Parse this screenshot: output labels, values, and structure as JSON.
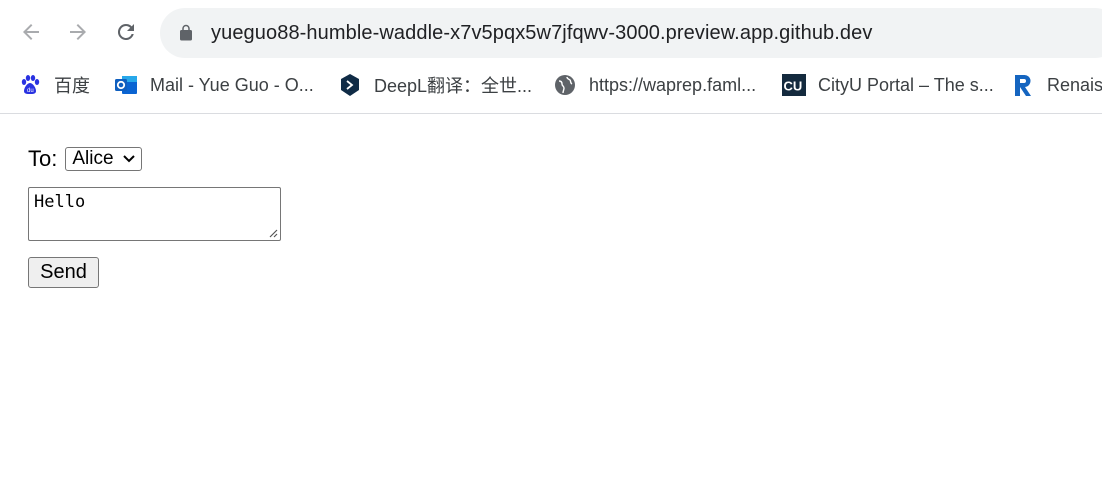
{
  "browser": {
    "url": "yueguo88-humble-waddle-x7v5pqx5w7jfqwv-3000.preview.app.github.dev",
    "icons": {
      "back": "arrow-left-icon",
      "forward": "arrow-right-icon",
      "reload": "reload-icon",
      "lock": "lock-icon"
    }
  },
  "bookmarks": [
    {
      "label": "百度",
      "icon": "baidu-paw-icon"
    },
    {
      "label": "Mail - Yue Guo - O...",
      "icon": "outlook-icon"
    },
    {
      "label": "DeepL翻译：全世...",
      "icon": "deepl-icon"
    },
    {
      "label": "https://waprep.faml...",
      "icon": "globe-icon"
    },
    {
      "label": "CityU Portal – The s...",
      "icon": "cityu-icon"
    },
    {
      "label": "Renaiss",
      "icon": "r-logo-icon"
    }
  ],
  "form": {
    "to_label": "To:",
    "recipient_selected": "Alice",
    "message_value": "Hello",
    "send_label": "Send"
  },
  "colors": {
    "chrome_background": "#f1f3f4",
    "text": "#202124",
    "button_background": "#efefef",
    "border": "#767676"
  }
}
